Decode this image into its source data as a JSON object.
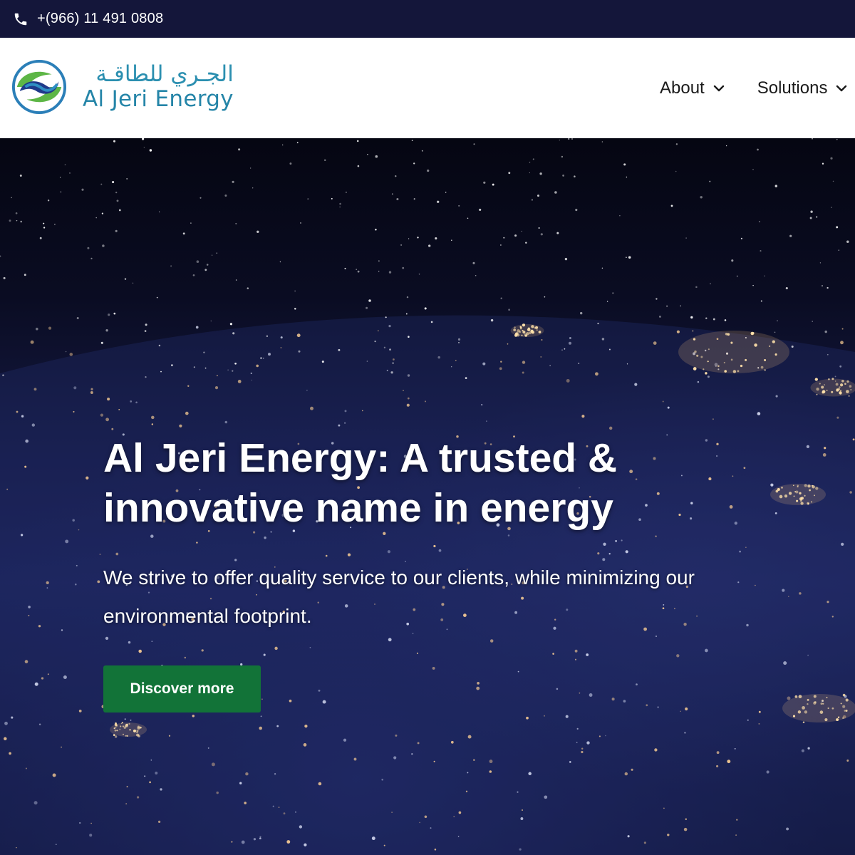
{
  "topbar": {
    "phone_icon": "phone-icon",
    "phone": "+(966) 11 491 0808"
  },
  "header": {
    "logo": {
      "arabic": "الجـري للطاقـة",
      "english": "Al Jeri Energy",
      "colors": {
        "blue": "#2585a8",
        "green": "#5db646",
        "navy": "#1f3a8a"
      }
    },
    "nav": [
      {
        "label": "About",
        "icon": "chevron-down-icon"
      },
      {
        "label": "Solutions",
        "icon": "chevron-down-icon"
      }
    ]
  },
  "hero": {
    "title": "Al Jeri Energy: A trusted & innovative name in energy",
    "subtitle": "We strive to offer quality service to our clients, while minimizing our environmental footprint.",
    "cta": "Discover more",
    "cta_color": "#127338"
  },
  "colors": {
    "topbar_bg": "#14163a",
    "header_bg": "#ffffff"
  }
}
